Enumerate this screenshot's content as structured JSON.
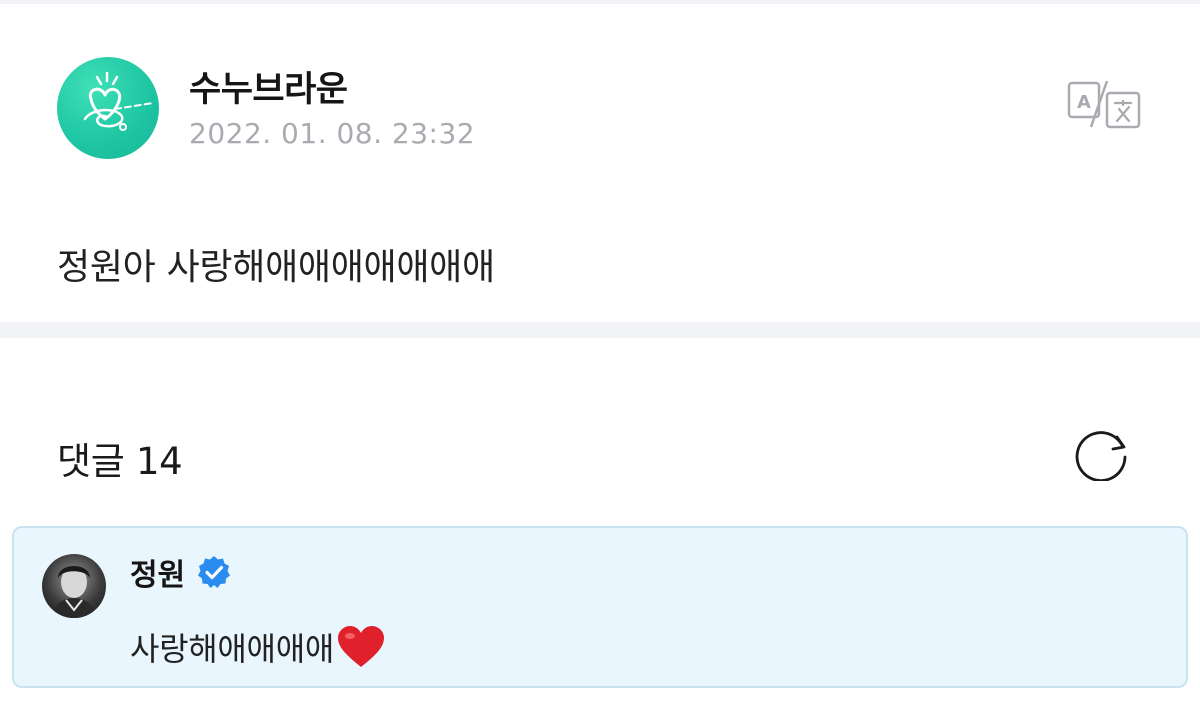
{
  "post": {
    "author": "수누브라운",
    "timestamp": "2022. 01. 08. 23:32",
    "body": "정원아 사랑해애애애애애애애",
    "avatar_icon": "heart-doodle-avatar",
    "translate_icon": "translate-icon"
  },
  "comments": {
    "title": "댓글 14",
    "refresh_icon": "refresh-icon",
    "items": [
      {
        "author": "정원",
        "verified": true,
        "text": "사랑해애애애애",
        "emoji": "heart-icon"
      }
    ]
  },
  "colors": {
    "accent_green": "#1fc7a4",
    "verified_blue": "#2a8cf0",
    "card_bg": "#eaf6fd",
    "card_border": "#c9e4f1",
    "timestamp_gray": "#a9abb1",
    "heart_red": "#e0202a"
  }
}
